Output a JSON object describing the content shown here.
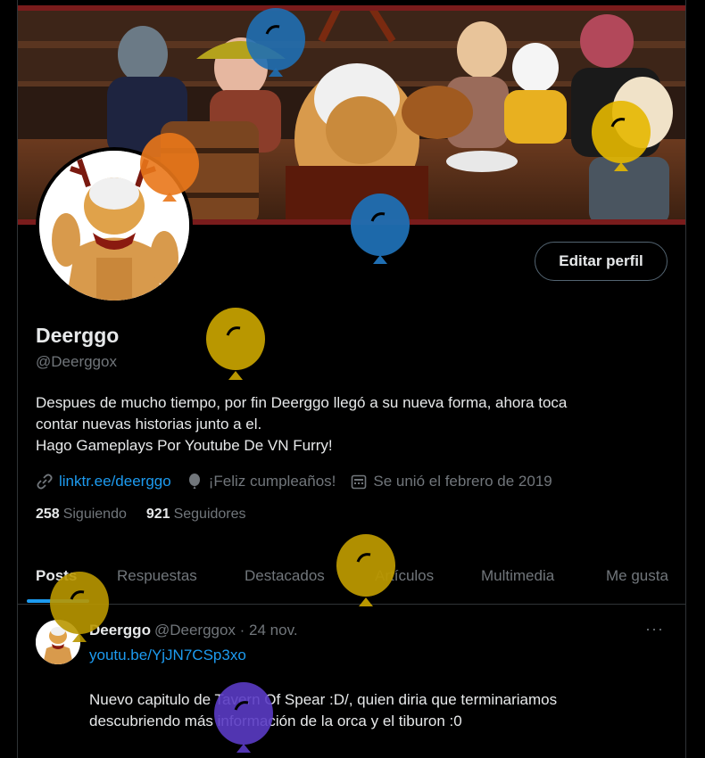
{
  "profile": {
    "display_name": "Deerggo",
    "handle": "@Deerggox",
    "bio_lines": [
      "Despues de mucho tiempo, por fin Deerggo llegó a su nueva forma, ahora toca",
      "contar nuevas historias junto a el.",
      "Hago Gameplays Por Youtube De VN Furry!"
    ],
    "website": "linktr.ee/deerggo",
    "birthday": "¡Feliz cumpleaños!",
    "joined": "Se unió el febrero de 2019",
    "following_count": "258",
    "following_label": "Siguiendo",
    "followers_count": "921",
    "followers_label": "Seguidores",
    "edit_button": "Editar perfil"
  },
  "tabs": [
    {
      "label": "Posts",
      "active": true
    },
    {
      "label": "Respuestas",
      "active": false
    },
    {
      "label": "Destacados",
      "active": false
    },
    {
      "label": "Artículos",
      "active": false
    },
    {
      "label": "Multimedia",
      "active": false
    },
    {
      "label": "Me gusta",
      "active": false
    }
  ],
  "tweet": {
    "name": "Deerggo",
    "handle_time": "@Deerggox · 24 nov.",
    "more": "···",
    "link": "youtu.be/YjJN7CSp3xo",
    "text_lines": [
      "Nuevo capitulo de Tavern Of Spear :D/, quien diria que terminariamos",
      "descubriendo más información de la orca y el tiburon :0"
    ]
  },
  "icons": {
    "link": "link-icon",
    "birthday": "balloon-icon",
    "calendar": "calendar-icon",
    "more": "more-icon"
  },
  "colors": {
    "background": "#000000",
    "text": "#e7e9ea",
    "muted": "#71767b",
    "accent": "#1d9bf0",
    "border": "#2f3336",
    "balloon_blue": "#1f6fb3",
    "balloon_orange": "#e9771a",
    "balloon_yellow": "#e6b800",
    "balloon_olive": "#b99700",
    "balloon_purple": "#5a3bc4"
  }
}
